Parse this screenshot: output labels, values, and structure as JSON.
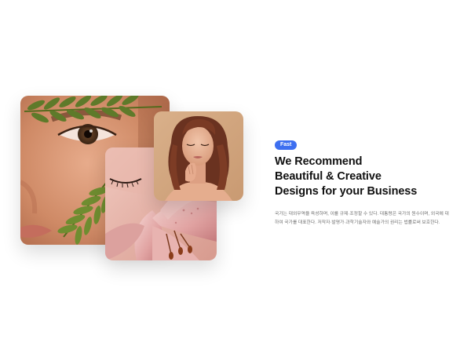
{
  "badge": {
    "label": "Fast",
    "color": "#3d6ff0"
  },
  "heading": {
    "lines": [
      "We Recommend",
      "Beautiful & Creative",
      "Designs for your Business"
    ]
  },
  "description": {
    "lines": [
      "국가는 대외무역을 육성하며, 이를 규제·조정할 수 있다. 대통령은 국가의 원수이며, 외국에 대",
      "하여 국가를 대표한다. 저작자·발명가·과학기술자와 예술가의 권리는 법률로써 보호한다."
    ]
  },
  "images": {
    "face_closeup": "face-with-leaves-photo",
    "flower_closeup": "face-with-lily-photo",
    "model_portrait": "woman-portrait-photo"
  }
}
